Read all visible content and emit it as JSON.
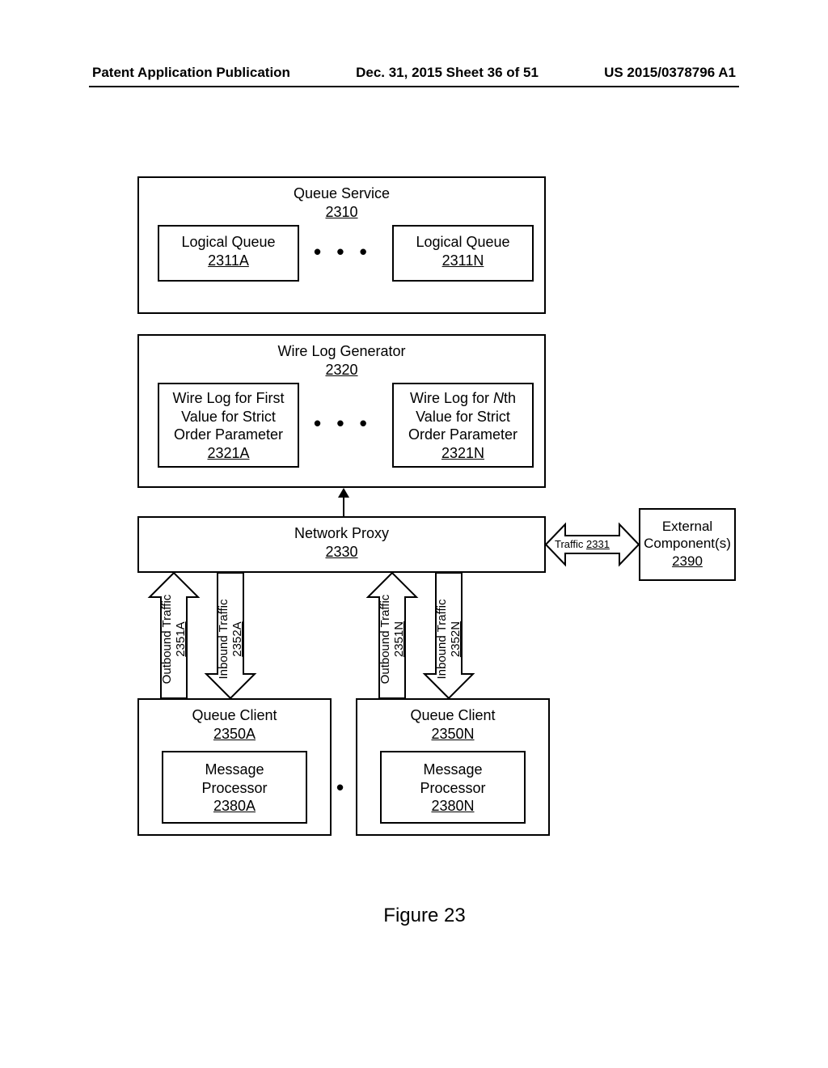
{
  "header": {
    "left": "Patent Application Publication",
    "center": "Dec. 31, 2015  Sheet 36 of 51",
    "right": "US 2015/0378796 A1"
  },
  "queue_service": {
    "title": "Queue Service",
    "ref": "2310"
  },
  "logical_queues": {
    "a": {
      "title": "Logical Queue",
      "ref": "2311A"
    },
    "n": {
      "title": "Logical Queue",
      "ref": "2311N"
    }
  },
  "wire_log_generator": {
    "title": "Wire Log Generator",
    "ref": "2320"
  },
  "wire_logs": {
    "a": {
      "l1": "Wire Log for First",
      "l2": "Value for Strict",
      "l3": "Order Parameter",
      "ref": "2321A"
    },
    "n": {
      "l1_pre": "Wire Log for ",
      "l1_em": "N",
      "l1_post": "th",
      "l2": "Value for Strict",
      "l3": "Order Parameter",
      "ref": "2321N"
    }
  },
  "network_proxy": {
    "title": "Network Proxy",
    "ref": "2330"
  },
  "external": {
    "l1": "External",
    "l2": "Component(s)",
    "ref": "2390"
  },
  "traffic_external": {
    "label": "Traffic ",
    "ref": "2331"
  },
  "vert_traffic": {
    "out_a": {
      "label": "Outbound Traffic",
      "ref": "2351A"
    },
    "in_a": {
      "label": "Inbound Traffic",
      "ref": "2352A"
    },
    "out_n": {
      "label": "Outbound Traffic",
      "ref": "2351N"
    },
    "in_n": {
      "label": "Inbound Traffic",
      "ref": "2352N"
    }
  },
  "queue_clients": {
    "a": {
      "title": "Queue Client",
      "ref": "2350A"
    },
    "n": {
      "title": "Queue Client",
      "ref": "2350N"
    }
  },
  "msg_proc": {
    "a": {
      "l1": "Message",
      "l2": "Processor",
      "ref": "2380A"
    },
    "n": {
      "l1": "Message",
      "l2": "Processor",
      "ref": "2380N"
    }
  },
  "dots": "•  •  •",
  "figure_caption": "Figure 23",
  "chart_data": {
    "type": "diagram",
    "title": "Figure 23",
    "description": "Block diagram of a queue service architecture with wire log generator, network proxy, queue clients and external components.",
    "nodes": [
      {
        "id": "2310",
        "label": "Queue Service",
        "children": [
          "2311A",
          "2311N"
        ]
      },
      {
        "id": "2311A",
        "label": "Logical Queue 2311A"
      },
      {
        "id": "2311N",
        "label": "Logical Queue 2311N"
      },
      {
        "id": "2320",
        "label": "Wire Log Generator",
        "children": [
          "2321A",
          "2321N"
        ]
      },
      {
        "id": "2321A",
        "label": "Wire Log for First Value for Strict Order Parameter 2321A"
      },
      {
        "id": "2321N",
        "label": "Wire Log for Nth Value for Strict Order Parameter 2321N"
      },
      {
        "id": "2330",
        "label": "Network Proxy"
      },
      {
        "id": "2390",
        "label": "External Component(s)"
      },
      {
        "id": "2350A",
        "label": "Queue Client 2350A",
        "children": [
          "2380A"
        ]
      },
      {
        "id": "2350N",
        "label": "Queue Client 2350N",
        "children": [
          "2380N"
        ]
      },
      {
        "id": "2380A",
        "label": "Message Processor 2380A"
      },
      {
        "id": "2380N",
        "label": "Message Processor 2380N"
      }
    ],
    "edges": [
      {
        "from": "2330",
        "to": "2320",
        "label": "",
        "dir": "up"
      },
      {
        "from": "2350A",
        "to": "2330",
        "label": "Outbound Traffic 2351A",
        "dir": "up"
      },
      {
        "from": "2330",
        "to": "2350A",
        "label": "Inbound Traffic 2352A",
        "dir": "down"
      },
      {
        "from": "2350N",
        "to": "2330",
        "label": "Outbound Traffic 2351N",
        "dir": "up"
      },
      {
        "from": "2330",
        "to": "2350N",
        "label": "Inbound Traffic 2352N",
        "dir": "down"
      },
      {
        "from": "2330",
        "to": "2390",
        "label": "Traffic 2331",
        "dir": "both"
      }
    ]
  }
}
